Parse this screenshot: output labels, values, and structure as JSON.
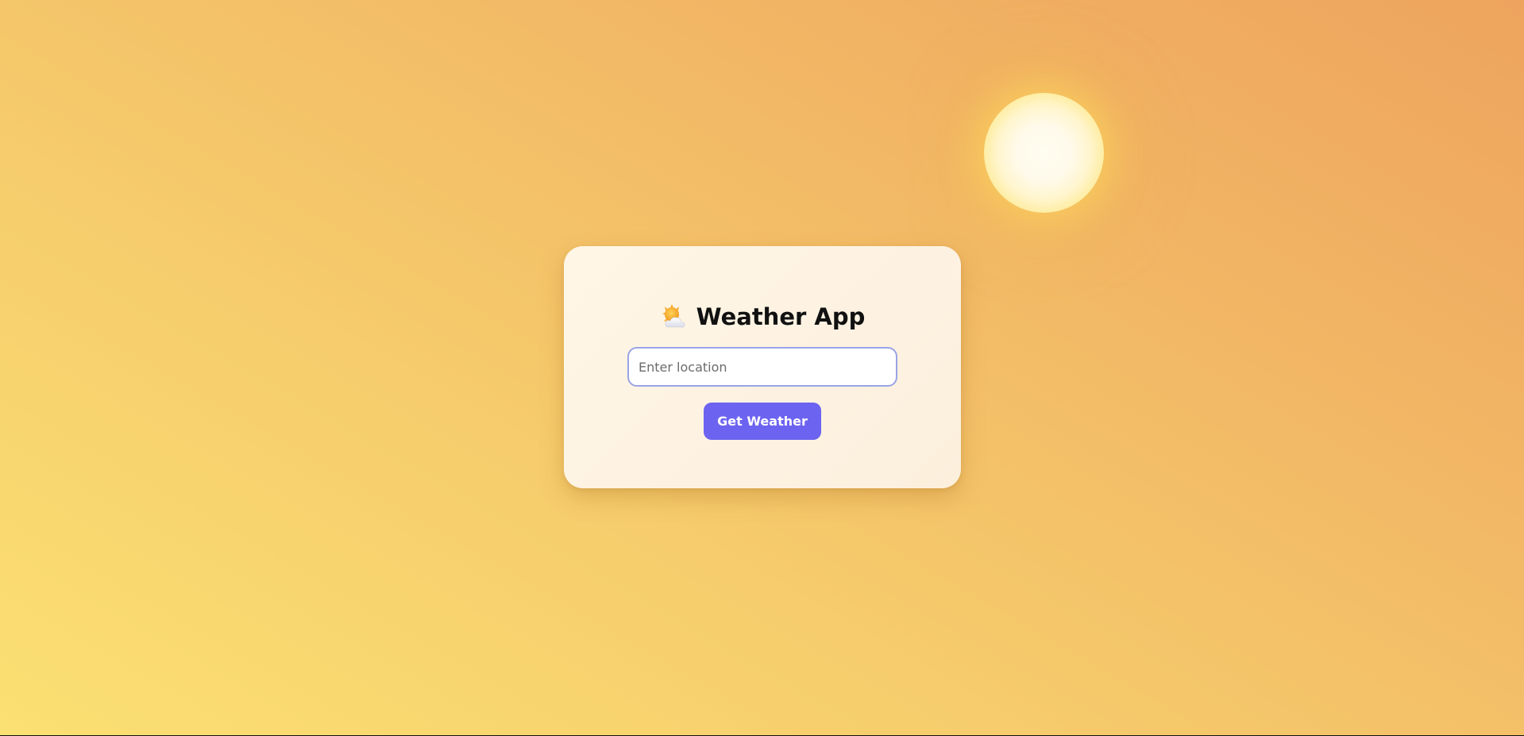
{
  "app": {
    "title": "Weather App",
    "title_icon": "sun-behind-cloud-icon"
  },
  "search": {
    "placeholder": "Enter location",
    "value": ""
  },
  "actions": {
    "get_weather_label": "Get Weather"
  },
  "decor": {
    "sun_icon": "sun-icon"
  },
  "colors": {
    "button": "#6c63f0",
    "input_border": "#9aa3e6",
    "card": "#fdf2e2",
    "background_light": "#fbe073",
    "background_dark": "#eea45e"
  }
}
